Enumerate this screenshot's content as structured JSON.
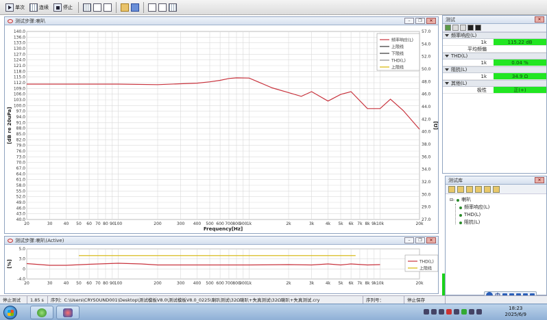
{
  "toolbar": {
    "single_label": "单次",
    "continuous_label": "连续",
    "stop_label": "停止",
    "icons": [
      "play-icon",
      "continuous-icon",
      "stop-icon",
      "grid-view-icon",
      "list-view-icon",
      "document-icon",
      "open-folder-icon",
      "save-icon",
      "window-icon",
      "export-icon",
      "split-view-icon"
    ]
  },
  "main_window": {
    "title": "测试步骤:喇叭"
  },
  "sub_window": {
    "title": "测试步骤:喇叭(Active)"
  },
  "right_panel": {
    "title": "测试",
    "groups": [
      {
        "label": "频率响应(L)",
        "rows": [
          {
            "key": "1k",
            "value": "115.22 dB",
            "highlight": true
          },
          {
            "key": "平均频偏",
            "value": "",
            "highlight": false
          }
        ]
      },
      {
        "label": "THD(L)",
        "rows": [
          {
            "key": "1k",
            "value": "0.04 %",
            "highlight": true
          }
        ]
      },
      {
        "label": "阻抗(L)",
        "rows": [
          {
            "key": "1k",
            "value": "34.9 Ω",
            "highlight": true
          }
        ]
      },
      {
        "label": "其他(L)",
        "rows": [
          {
            "key": "极性",
            "value": "正(+)",
            "highlight": true
          }
        ]
      }
    ]
  },
  "library": {
    "title": "测试库",
    "root": "喇叭",
    "items": [
      "频率响应(L)",
      "THD(L)",
      "阻抗(L)"
    ]
  },
  "status": {
    "state": "停止测试",
    "time": "1.85 s",
    "file_label": "序列：",
    "file_path": "C:\\Users\\CRYSOUND001\\Desktop\\测试模板V8.0\\测试模板V8.0_0225\\喇叭测试\\32Ω喇叭+失真测试\\32Ω喇叭+失真测试.cry",
    "seq_label": "序列号：",
    "save_label": "停止保存"
  },
  "taskbar": {
    "time": "18:23",
    "date": "2025/6/9"
  },
  "ime": {
    "label": "中"
  },
  "chart_data": [
    {
      "type": "line",
      "xlabel": "Frequency[Hz]",
      "ylabel": "[dB re 20uPa]",
      "ylabel_right": "[Ω]",
      "x_scale": "log",
      "xlim": [
        20,
        20000
      ],
      "ylim": [
        40.0,
        140.0
      ],
      "ylim_right": [
        27.0,
        57.0
      ],
      "x_ticks": [
        {
          "v": 20,
          "t": "20"
        },
        {
          "v": 30,
          "t": "30"
        },
        {
          "v": 40,
          "t": "40"
        },
        {
          "v": 50,
          "t": "50"
        },
        {
          "v": 60,
          "t": "60"
        },
        {
          "v": 70,
          "t": "70"
        },
        {
          "v": 80,
          "t": "80"
        },
        {
          "v": 90,
          "t": "90"
        },
        {
          "v": 100,
          "t": "100"
        },
        {
          "v": 200,
          "t": "200"
        },
        {
          "v": 300,
          "t": "300"
        },
        {
          "v": 400,
          "t": "400"
        },
        {
          "v": 500,
          "t": "500"
        },
        {
          "v": 600,
          "t": "600"
        },
        {
          "v": 700,
          "t": "700"
        },
        {
          "v": 800,
          "t": "800"
        },
        {
          "v": 900,
          "t": "900"
        },
        {
          "v": 1000,
          "t": "1k"
        },
        {
          "v": 2000,
          "t": "2k"
        },
        {
          "v": 3000,
          "t": "3k"
        },
        {
          "v": 4000,
          "t": "4k"
        },
        {
          "v": 5000,
          "t": "5k"
        },
        {
          "v": 6000,
          "t": "6k"
        },
        {
          "v": 7000,
          "t": "7k"
        },
        {
          "v": 8000,
          "t": "8k"
        },
        {
          "v": 9000,
          "t": "9k"
        },
        {
          "v": 10000,
          "t": "10k"
        },
        {
          "v": 20000,
          "t": "20k"
        }
      ],
      "y_ticks": [
        "140.0",
        "136.0",
        "133.0",
        "130.0",
        "127.0",
        "124.0",
        "121.0",
        "118.0",
        "115.0",
        "112.0",
        "109.0",
        "106.0",
        "103.0",
        "100.0",
        "97.0",
        "94.0",
        "91.0",
        "88.0",
        "85.0",
        "82.0",
        "79.0",
        "76.0",
        "73.0",
        "70.0",
        "67.0",
        "64.0",
        "61.0",
        "58.0",
        "55.0",
        "52.0",
        "49.0",
        "46.0",
        "43.0",
        "40.0"
      ],
      "y_ticks_right": [
        "57.0",
        "54.0",
        "52.0",
        "50.0",
        "48.0",
        "46.0",
        "44.0",
        "42.0",
        "40.0",
        "38.0",
        "36.0",
        "34.0",
        "32.0",
        "30.0",
        "29.0",
        "27.0"
      ],
      "legend_position": "top-right",
      "legend": [
        {
          "name": "频率响应(L)",
          "color": "#c8323c"
        },
        {
          "name": "上限线",
          "color": "#333333"
        },
        {
          "name": "下限线",
          "color": "#333333"
        },
        {
          "name": "THD(L)",
          "color": "#888888"
        },
        {
          "name": "上限线",
          "color": "#d4b400"
        }
      ],
      "series": [
        {
          "name": "频率响应(L)",
          "color": "#c8323c",
          "x": [
            20,
            30,
            50,
            100,
            200,
            300,
            400,
            500,
            600,
            700,
            800,
            1000,
            1500,
            2000,
            2500,
            3000,
            4000,
            5000,
            6000,
            8000,
            10000,
            12000,
            15000,
            20000
          ],
          "y": [
            112.0,
            112.0,
            112.0,
            112.0,
            111.7,
            112.2,
            112.5,
            113.2,
            114.0,
            115.0,
            115.3,
            115.2,
            110.0,
            107.5,
            105.5,
            108.0,
            103.0,
            106.5,
            108.0,
            99.0,
            99.0,
            104.0,
            98.0,
            88.0
          ]
        }
      ]
    },
    {
      "type": "line",
      "xlabel": "",
      "ylabel": "[%]",
      "x_scale": "log",
      "xlim": [
        20,
        20000
      ],
      "ylim": [
        -4.0,
        5.0
      ],
      "y_ticks": [
        "5.0",
        "3.0",
        "0",
        "-4.0"
      ],
      "x_ticks": [
        {
          "v": 20,
          "t": "20"
        },
        {
          "v": 30,
          "t": "30"
        },
        {
          "v": 40,
          "t": "40"
        },
        {
          "v": 50,
          "t": "50"
        },
        {
          "v": 60,
          "t": "60"
        },
        {
          "v": 70,
          "t": "70"
        },
        {
          "v": 80,
          "t": "80"
        },
        {
          "v": 90,
          "t": "90"
        },
        {
          "v": 100,
          "t": "100"
        },
        {
          "v": 200,
          "t": "200"
        },
        {
          "v": 300,
          "t": "300"
        },
        {
          "v": 400,
          "t": "400"
        },
        {
          "v": 500,
          "t": "500"
        },
        {
          "v": 600,
          "t": "600"
        },
        {
          "v": 700,
          "t": "700"
        },
        {
          "v": 800,
          "t": "800"
        },
        {
          "v": 900,
          "t": "900"
        },
        {
          "v": 1000,
          "t": "1k"
        },
        {
          "v": 2000,
          "t": "2k"
        },
        {
          "v": 3000,
          "t": "3k"
        },
        {
          "v": 4000,
          "t": "4k"
        },
        {
          "v": 5000,
          "t": "5k"
        },
        {
          "v": 6000,
          "t": "6k"
        },
        {
          "v": 7000,
          "t": "7k"
        },
        {
          "v": 8000,
          "t": "8k"
        },
        {
          "v": 9000,
          "t": "9k"
        },
        {
          "v": 10000,
          "t": "10k"
        },
        {
          "v": 20000,
          "t": "20k"
        }
      ],
      "legend_position": "right",
      "legend": [
        {
          "name": "THD(L)",
          "color": "#c8323c"
        },
        {
          "name": "上限线",
          "color": "#d4b400"
        }
      ],
      "series": [
        {
          "name": "THD(L)",
          "color": "#c8323c",
          "x": [
            20,
            30,
            40,
            60,
            100,
            150,
            200,
            300,
            500,
            1000,
            2000,
            3000,
            4000,
            5000,
            6000,
            8000,
            10000
          ],
          "y": [
            0.6,
            0.1,
            0.1,
            0.4,
            0.7,
            0.5,
            0.2,
            0.2,
            0.2,
            0.2,
            0.3,
            0.2,
            0.5,
            0.2,
            0.5,
            0.2,
            0.3
          ]
        },
        {
          "name": "上限线",
          "color": "#d4b400",
          "x": [
            50,
            6500
          ],
          "y": [
            3.0,
            3.0
          ]
        }
      ]
    }
  ]
}
